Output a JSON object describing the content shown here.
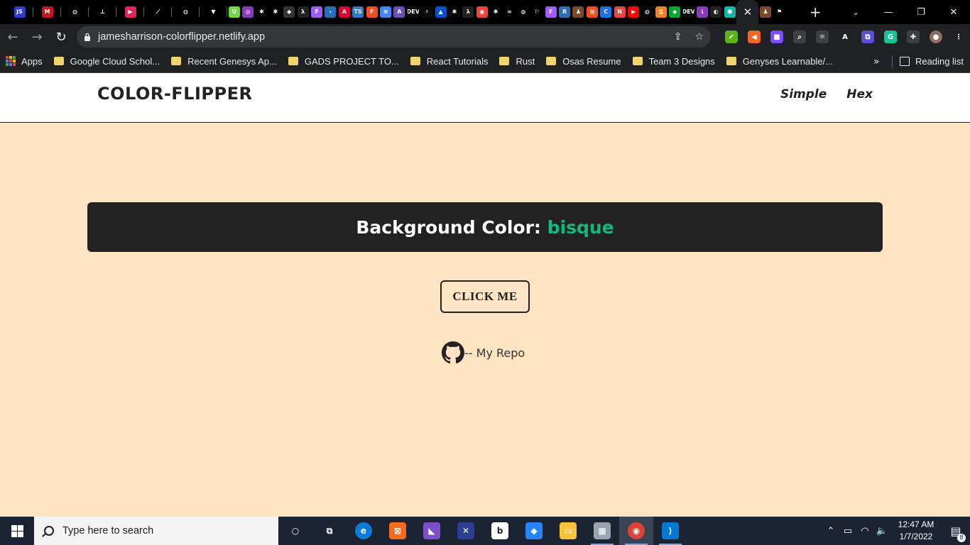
{
  "browser": {
    "active_tab_close": "✕",
    "new_tab": "+",
    "tab_search": "⌄",
    "window_controls": {
      "minimize": "—",
      "restore": "❐",
      "close": "✕"
    },
    "url": "jamesharrison-colorflipper.netlify.app",
    "nav": {
      "back": "←",
      "forward": "→",
      "reload": "↻"
    },
    "omnibox_icons": {
      "share": "⇪",
      "bookmark_star": "☆"
    },
    "tabs": [
      {
        "icon": "js-icon",
        "glyph": "JS",
        "color": "#2a3bd6"
      },
      {
        "icon": "medium-m-icon",
        "glyph": "M",
        "color": "#c4161c"
      },
      {
        "icon": "globe-icon",
        "glyph": "◍",
        "color": "#000000"
      },
      {
        "icon": "antenna-icon",
        "glyph": "⊥",
        "color": "#000000"
      },
      {
        "icon": "play-circle-icon",
        "glyph": "▶",
        "color": "#e0245e"
      },
      {
        "icon": "feather-icon",
        "glyph": "⟋",
        "color": "#000000"
      },
      {
        "icon": "globe-icon",
        "glyph": "◍",
        "color": "#000000"
      },
      {
        "icon": "yellow-shield-icon",
        "glyph": "▼",
        "color": "#000000"
      }
    ],
    "pinned_tabs": [
      {
        "icon": "upwork-icon",
        "glyph": "U",
        "color": "#6fda44"
      },
      {
        "icon": "purple-app-icon",
        "glyph": "◎",
        "color": "#8a3ab9"
      },
      {
        "icon": "asterisk-icon",
        "glyph": "✱",
        "color": "#000000"
      },
      {
        "icon": "asterisk-icon",
        "glyph": "✱",
        "color": "#000000"
      },
      {
        "icon": "diamond-icon",
        "glyph": "◆",
        "color": "#333333"
      },
      {
        "icon": "lambda-icon",
        "glyph": "λ",
        "color": "#222222"
      },
      {
        "icon": "figma-icon",
        "glyph": "F",
        "color": "#a259ff"
      },
      {
        "icon": "powershell-icon",
        "glyph": "›",
        "color": "#2671be"
      },
      {
        "icon": "angular-icon",
        "glyph": "A",
        "color": "#dd0031"
      },
      {
        "icon": "typescript-icon",
        "glyph": "TS",
        "color": "#3178c6"
      },
      {
        "icon": "figma-icon",
        "glyph": "F",
        "color": "#f24e1e"
      },
      {
        "icon": "docs-icon",
        "glyph": "≡",
        "color": "#4285f4"
      },
      {
        "icon": "a-logo-icon",
        "glyph": "A",
        "color": "#6b4fbb"
      },
      {
        "icon": "dev-icon",
        "glyph": "DEV",
        "color": "#0a0a0a"
      },
      {
        "icon": "bolt-icon",
        "glyph": "⚡",
        "color": "#0a0a0a"
      },
      {
        "icon": "atlassian-icon",
        "glyph": "▲",
        "color": "#0052cc"
      },
      {
        "icon": "asterisk-icon",
        "glyph": "✱",
        "color": "#000000"
      },
      {
        "icon": "lambda-icon",
        "glyph": "λ",
        "color": "#222222"
      },
      {
        "icon": "record-icon",
        "glyph": "◉",
        "color": "#e8453c"
      },
      {
        "icon": "asterisk-icon",
        "glyph": "✱",
        "color": "#000000"
      },
      {
        "icon": "loop-icon",
        "glyph": "∞",
        "color": "#000000"
      },
      {
        "icon": "globe-icon",
        "glyph": "◍",
        "color": "#000000"
      },
      {
        "icon": "flag-icon",
        "glyph": "⚐",
        "color": "#000000"
      },
      {
        "icon": "figma-icon",
        "glyph": "F",
        "color": "#a259ff"
      },
      {
        "icon": "r-icon",
        "glyph": "R",
        "color": "#2a6ebb"
      },
      {
        "icon": "person-icon",
        "glyph": "♟",
        "color": "#7a4a2a"
      },
      {
        "icon": "microsoft-icon",
        "glyph": "⊞",
        "color": "#f25022"
      },
      {
        "icon": "chrome-c-icon",
        "glyph": "C",
        "color": "#1a73e8"
      },
      {
        "icon": "notion-icon",
        "glyph": "N",
        "color": "#e8453c"
      },
      {
        "icon": "youtube-icon",
        "glyph": "▶",
        "color": "#ff0000"
      },
      {
        "icon": "globe-icon",
        "glyph": "◍",
        "color": "#000000"
      },
      {
        "icon": "stackoverflow-icon",
        "glyph": "≣",
        "color": "#f48024"
      },
      {
        "icon": "evernote-icon",
        "glyph": "◆",
        "color": "#00a82d"
      },
      {
        "icon": "dev-icon",
        "glyph": "DEV",
        "color": "#0a0a0a"
      },
      {
        "icon": "info-icon",
        "glyph": "ℹ",
        "color": "#8a3ab9"
      },
      {
        "icon": "github-icon",
        "glyph": "◐",
        "color": "#222222"
      },
      {
        "icon": "hexagon-icon",
        "glyph": "⬢",
        "color": "#14b8a6"
      }
    ],
    "trailing_tabs": [
      {
        "icon": "person-icon",
        "glyph": "♟",
        "color": "#7a4a2a"
      },
      {
        "icon": "flag-icon",
        "glyph": "⚑",
        "color": "#000000"
      }
    ]
  },
  "extensions": [
    {
      "icon": "green-check-icon",
      "glyph": "✔",
      "color": "#5bb318"
    },
    {
      "icon": "speaker-icon",
      "glyph": "◀",
      "color": "#f26522"
    },
    {
      "icon": "gradient-app-icon",
      "glyph": "■",
      "color": "#7c4dff"
    },
    {
      "icon": "search-extension-icon",
      "glyph": "⌕",
      "color": "#3c4043"
    },
    {
      "icon": "react-icon",
      "glyph": "⚛",
      "color": "#3c4043"
    },
    {
      "icon": "a-extension-icon",
      "glyph": "A",
      "color": "#202124"
    },
    {
      "icon": "puzzle-app-icon",
      "glyph": "⧉",
      "color": "#5b4fd6"
    },
    {
      "icon": "grammarly-icon",
      "glyph": "G",
      "color": "#15c39a"
    },
    {
      "icon": "puzzle-icon",
      "glyph": "✚",
      "color": "#3c4043"
    },
    {
      "icon": "profile-avatar-icon",
      "glyph": "●",
      "color": "#8d6e63"
    },
    {
      "icon": "kebab-menu-icon",
      "glyph": "⋮",
      "color": "#202124"
    }
  ],
  "bookmarks": {
    "apps_label": "Apps",
    "items": [
      "Google Cloud Schol...",
      "Recent Genesys Ap...",
      "GADS PROJECT TO...",
      "React Tutorials",
      "Rust",
      "Osas Resume",
      "Team 3 Designs",
      "Genyses Learnable/..."
    ],
    "more": "»",
    "reading_list": "Reading list"
  },
  "app": {
    "brand": "COLOR-FLIPPER",
    "nav_links": [
      "Simple",
      "Hex"
    ],
    "background_label": "Background Color:",
    "color_name": "bisque",
    "background_color": "#ffe4c4",
    "accent_color": "#10b981",
    "button_label": "CLICK ME",
    "repo_text": "-- My Repo"
  },
  "taskbar": {
    "search_placeholder": "Type here to search",
    "apps": [
      {
        "name": "cortana-icon",
        "glyph": "○",
        "color": "transparent"
      },
      {
        "name": "task-view-icon",
        "glyph": "⧉",
        "color": "transparent"
      },
      {
        "name": "edge-icon",
        "glyph": "e",
        "color": "#0c7bd8"
      },
      {
        "name": "xampp-icon",
        "glyph": "⊠",
        "color": "#f26b21"
      },
      {
        "name": "visual-studio-icon",
        "glyph": "◣",
        "color": "#7a4fc9"
      },
      {
        "name": "xcross-icon",
        "glyph": "✕",
        "color": "#2c3e91"
      },
      {
        "name": "bitbucket-icon",
        "glyph": "b",
        "color": "#ffffff"
      },
      {
        "name": "sourcetree-icon",
        "glyph": "◆",
        "color": "#2684ff"
      },
      {
        "name": "file-explorer-icon",
        "glyph": "▭",
        "color": "#f8c538"
      },
      {
        "name": "photos-app-icon",
        "glyph": "▦",
        "color": "#9aa5b1"
      },
      {
        "name": "chrome-icon",
        "glyph": "◉",
        "color": "#db4437"
      },
      {
        "name": "vscode-icon",
        "glyph": "⟩",
        "color": "#0078d4"
      }
    ],
    "tray": {
      "chevron": "⌃",
      "battery": "▭",
      "wifi": "◠",
      "volume": "🔈"
    },
    "time": "12:47 AM",
    "date": "1/7/2022",
    "notification_count": "8"
  }
}
